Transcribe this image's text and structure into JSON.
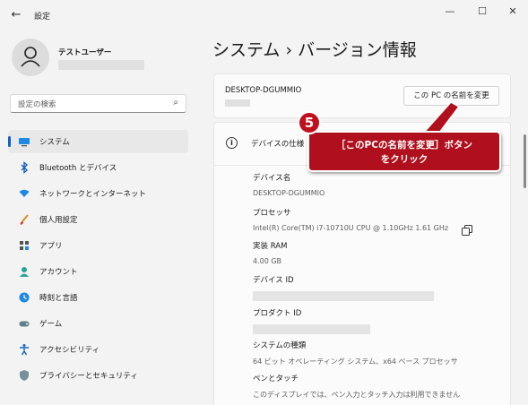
{
  "window": {
    "title": "設定",
    "back_glyph": "←",
    "min_glyph": "—",
    "max_glyph": "☐",
    "close_glyph": "✕"
  },
  "user": {
    "name": "テストユーザー"
  },
  "search": {
    "placeholder": "設定の検索",
    "icon_glyph": "⌕"
  },
  "sidebar": {
    "items": [
      {
        "label": "システム",
        "icon": "monitor-icon",
        "active": true
      },
      {
        "label": "Bluetooth とデバイス",
        "icon": "bluetooth-icon"
      },
      {
        "label": "ネットワークとインターネット",
        "icon": "wifi-icon"
      },
      {
        "label": "個人用設定",
        "icon": "brush-icon"
      },
      {
        "label": "アプリ",
        "icon": "apps-icon"
      },
      {
        "label": "アカウント",
        "icon": "account-icon"
      },
      {
        "label": "時刻と言語",
        "icon": "globe-clock-icon"
      },
      {
        "label": "ゲーム",
        "icon": "gamepad-icon"
      },
      {
        "label": "アクセシビリティ",
        "icon": "accessibility-icon"
      },
      {
        "label": "プライバシーとセキュリティ",
        "icon": "shield-icon"
      }
    ]
  },
  "page": {
    "title": "システム  ›  バージョン情報"
  },
  "device": {
    "name": "DESKTOP-DGUMMIO",
    "rename_label": "この PC の名前を変更"
  },
  "specs": {
    "header": "デバイスの仕様",
    "device_name_label": "デバイス名",
    "device_name_value": "DESKTOP-DGUMMIO",
    "processor_label": "プロセッサ",
    "processor_value": "Intel(R) Core(TM) i7-10710U CPU @ 1.10GHz   1.61 GHz",
    "ram_label": "実装 RAM",
    "ram_value": "4.00 GB",
    "device_id_label": "デバイス ID",
    "product_id_label": "プロダクト ID",
    "system_type_label": "システムの種類",
    "system_type_value": "64 ビット オペレーティング システム、x64 ベース プロセッサ",
    "pen_touch_label": "ペンとタッチ",
    "pen_touch_value": "このディスプレイでは、ペン入力とタッチ入力は利用できません"
  },
  "annotation": {
    "step": "5",
    "line1": "［このPCの名前を変更］ボタン",
    "line2": "をクリック",
    "color": "#b0101d"
  },
  "colors": {
    "accent": "#0f62c4",
    "background": "#f3f3f3",
    "card": "#fbfbfb"
  }
}
